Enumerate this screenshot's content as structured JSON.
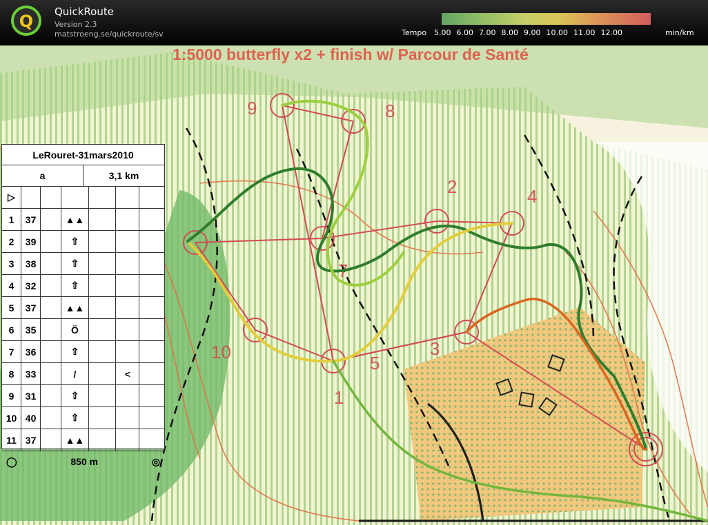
{
  "app": {
    "title": "QuickRoute",
    "version": "Version 2.3",
    "url": "matstroeng.se/quickroute/sv",
    "tempo_label": "Tempo",
    "tempo_ticks": [
      "5.00",
      "6.00",
      "7.00",
      "8.00",
      "9.00",
      "10.00",
      "11.00",
      "12.00"
    ],
    "tempo_unit": "min/km"
  },
  "map": {
    "title": "1:5000 butterfly x2 + finish w/ Parcour de Santé"
  },
  "card": {
    "event": "LeRouret-31mars2010",
    "class": "a",
    "distance": "3,1 km",
    "finish_distance": "850 m",
    "controls": [
      {
        "n": "1",
        "code": "37",
        "symbol": "▲▲"
      },
      {
        "n": "2",
        "code": "39",
        "symbol": "⇧"
      },
      {
        "n": "3",
        "code": "38",
        "symbol": "⇧"
      },
      {
        "n": "4",
        "code": "32",
        "symbol": "⇧"
      },
      {
        "n": "5",
        "code": "37",
        "symbol": "▲▲"
      },
      {
        "n": "6",
        "code": "35",
        "symbol": "Ö"
      },
      {
        "n": "7",
        "code": "36",
        "symbol": "⇧"
      },
      {
        "n": "8",
        "code": "33",
        "symbol": "/",
        "extra": "<"
      },
      {
        "n": "9",
        "code": "31",
        "symbol": "⇧"
      },
      {
        "n": "10",
        "code": "40",
        "symbol": "⇧"
      },
      {
        "n": "11",
        "code": "37",
        "symbol": "▲▲"
      }
    ]
  }
}
